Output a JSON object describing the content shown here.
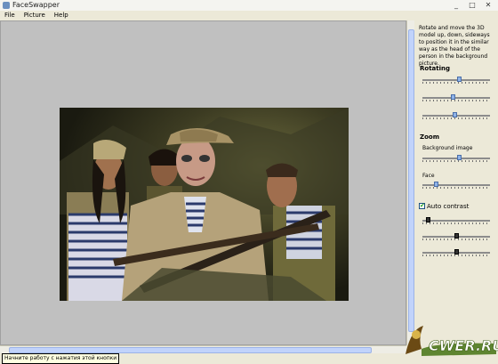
{
  "window": {
    "title": "FaceSwapper",
    "min": "_",
    "max": "□",
    "close": "✕"
  },
  "menu": [
    "File",
    "Picture",
    "Help"
  ],
  "panel": {
    "hint": "Rotate and move the 3D model up, down, sideways to position it in the similar way as the head of the person in the background picture.",
    "rotating_heading": "Rotating",
    "rotating_sliders": [
      0.55,
      0.45,
      0.48
    ],
    "zoom_heading": "Zoom",
    "background_label": "Background image",
    "background_value": 0.55,
    "face_label": "Face",
    "face_value": 0.18,
    "auto_contrast_label": "Auto contrast",
    "auto_contrast_checked": true,
    "contrast_sliders": [
      0.05,
      0.5,
      0.5
    ]
  },
  "status": {
    "tooltip": "Начните работу с нажатия этой кнопки"
  },
  "watermark": {
    "text": "CWER.RU",
    "color": "#ffffff"
  }
}
